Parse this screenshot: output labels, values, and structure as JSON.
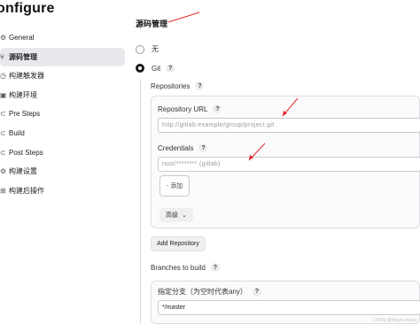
{
  "page": {
    "title": "onfigure"
  },
  "sidebar": {
    "items": [
      {
        "label": "General",
        "icon": "gear-icon",
        "active": false
      },
      {
        "label": "源码管理",
        "icon": "code-branch-icon",
        "active": true
      },
      {
        "label": "构建触发器",
        "icon": "clock-icon",
        "active": false
      },
      {
        "label": "构建环境",
        "icon": "environment-icon",
        "active": false
      },
      {
        "label": "Pre Steps",
        "icon": "pre-steps-icon",
        "active": false
      },
      {
        "label": "Build",
        "icon": "build-icon",
        "active": false
      },
      {
        "label": "Post Steps",
        "icon": "post-steps-icon",
        "active": false
      },
      {
        "label": "构建设置",
        "icon": "settings-icon",
        "active": false
      },
      {
        "label": "构建后操作",
        "icon": "post-build-icon",
        "active": false
      }
    ]
  },
  "scm": {
    "title": "源码管理",
    "none_label": "无",
    "git_label": "Git",
    "help": "?"
  },
  "repositories": {
    "label": "Repositories",
    "url_label": "Repository URL",
    "url_value": "http://gitlab.example/group/project.git",
    "credentials_label": "Credentials",
    "credentials_value": "root/******** (gitlab)",
    "add_label": "添加",
    "advanced_label": "高级",
    "add_repository_label": "Add Repository"
  },
  "branches": {
    "label": "Branches to build",
    "specifier_label": "指定分支（为空时代表any）",
    "specifier_value": "*/master"
  },
  "watermark": "CSDN @lingyq-zhang",
  "colors": {
    "arrow": "#e4262a",
    "active_item": "#e9e9ed"
  }
}
